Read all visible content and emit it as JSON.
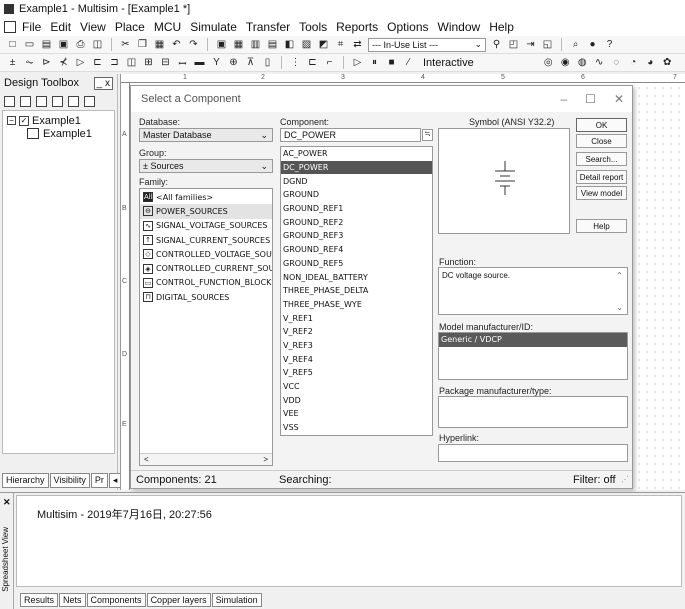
{
  "window": {
    "title": "Example1 - Multisim - [Example1 *]"
  },
  "menu": [
    "File",
    "Edit",
    "View",
    "Place",
    "MCU",
    "Simulate",
    "Transfer",
    "Tools",
    "Reports",
    "Options",
    "Window",
    "Help"
  ],
  "toolbar": {
    "inuse_list": "--- In-Use List ---",
    "interactive_label": "Interactive"
  },
  "toolbox": {
    "title": "Design Toolbox",
    "tree_root": "Example1",
    "tree_child": "Example1",
    "tabs": [
      "Hierarchy",
      "Visibility",
      "Pr"
    ]
  },
  "ruler": {
    "top": [
      "1",
      "2",
      "3",
      "4",
      "5",
      "6",
      "7"
    ],
    "left": [
      "A",
      "B",
      "C",
      "D",
      "E"
    ]
  },
  "dialog": {
    "title": "Select a Component",
    "database_label": "Database:",
    "database_value": "Master Database",
    "group_label": "Group:",
    "group_value": "Sources",
    "family_label": "Family:",
    "families": [
      {
        "icon": "All",
        "label": "<All families>"
      },
      {
        "icon": "PS",
        "label": "POWER_SOURCES"
      },
      {
        "icon": "SV",
        "label": "SIGNAL_VOLTAGE_SOURCES"
      },
      {
        "icon": "SC",
        "label": "SIGNAL_CURRENT_SOURCES"
      },
      {
        "icon": "CV",
        "label": "CONTROLLED_VOLTAGE_SOURCE"
      },
      {
        "icon": "CC",
        "label": "CONTROLLED_CURRENT_SOURCE"
      },
      {
        "icon": "CF",
        "label": "CONTROL_FUNCTION_BLOCKS"
      },
      {
        "icon": "DS",
        "label": "DIGITAL_SOURCES"
      }
    ],
    "component_label": "Component:",
    "component_value": "DC_POWER",
    "components": [
      "AC_POWER",
      "DC_POWER",
      "DGND",
      "GROUND",
      "GROUND_REF1",
      "GROUND_REF2",
      "GROUND_REF3",
      "GROUND_REF4",
      "GROUND_REF5",
      "NON_IDEAL_BATTERY",
      "THREE_PHASE_DELTA",
      "THREE_PHASE_WYE",
      "V_REF1",
      "V_REF2",
      "V_REF3",
      "V_REF4",
      "V_REF5",
      "VCC",
      "VDD",
      "VEE",
      "VSS"
    ],
    "selected_component_index": 1,
    "symbol_label": "Symbol (ANSI Y32.2)",
    "function_label": "Function:",
    "function_value": "DC voltage source.",
    "model_label": "Model manufacturer/ID:",
    "model_value": "Generic / VDCP",
    "package_label": "Package manufacturer/type:",
    "hyperlink_label": "Hyperlink:",
    "buttons": {
      "ok": "OK",
      "close": "Close",
      "search": "Search...",
      "detail_report": "Detail report",
      "view_model": "View model",
      "help": "Help"
    },
    "status_components": "Components: 21",
    "status_searching": "Searching:",
    "status_filter": "Filter: off"
  },
  "spreadsheet": {
    "side_label": "Spreadsheet View",
    "message": "Multisim  -  2019年7月16日, 20:27:56",
    "tabs": [
      "Results",
      "Nets",
      "Components",
      "Copper layers",
      "Simulation"
    ]
  }
}
